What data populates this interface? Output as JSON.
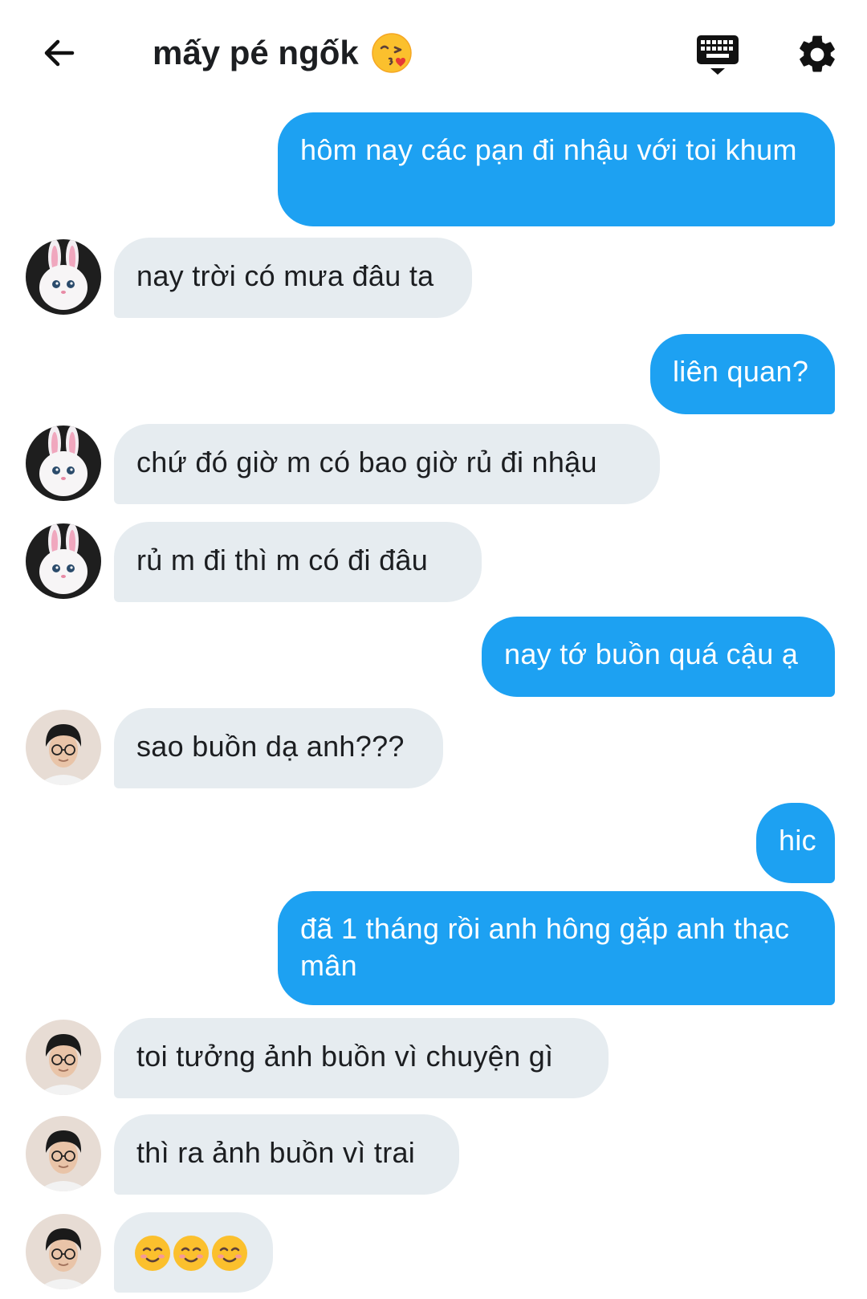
{
  "header": {
    "title": "mấy pé ngốk",
    "title_emoji": "face-blowing-kiss",
    "back_icon": "arrow-left-icon",
    "keyboard_icon": "keyboard-icon",
    "settings_icon": "gear-icon"
  },
  "colors": {
    "outgoing_bubble": "#1da1f2",
    "incoming_bubble": "#e6ecf0",
    "text_dark": "#1c1e21"
  },
  "messages": [
    {
      "dir": "out",
      "text": "hôm nay các pạn đi nhậu với toi khum"
    },
    {
      "dir": "in",
      "avatar": "bunny",
      "text": "nay trời có mưa đâu ta"
    },
    {
      "dir": "out",
      "text": "liên quan?"
    },
    {
      "dir": "in",
      "avatar": "bunny",
      "text": "chứ đó giờ m có bao giờ rủ đi nhậu"
    },
    {
      "dir": "in",
      "avatar": "bunny",
      "text": "rủ m đi thì m có đi đâu"
    },
    {
      "dir": "out",
      "text": "nay tớ buồn quá cậu ạ"
    },
    {
      "dir": "in",
      "avatar": "man",
      "text": "sao buồn dạ anh???"
    },
    {
      "dir": "out",
      "text": "hic"
    },
    {
      "dir": "out",
      "text": "đã 1 tháng rồi anh hông gặp anh thạc mân"
    },
    {
      "dir": "in",
      "avatar": "man",
      "text": "toi tưởng ảnh buồn vì chuyện gì"
    },
    {
      "dir": "in",
      "avatar": "man",
      "text": "thì ra ảnh buồn vì trai"
    },
    {
      "dir": "in",
      "avatar": "man",
      "text": "☺☺☺",
      "emoji_names": [
        "smiling-face-icon",
        "smiling-face-icon",
        "smiling-face-icon"
      ]
    }
  ]
}
